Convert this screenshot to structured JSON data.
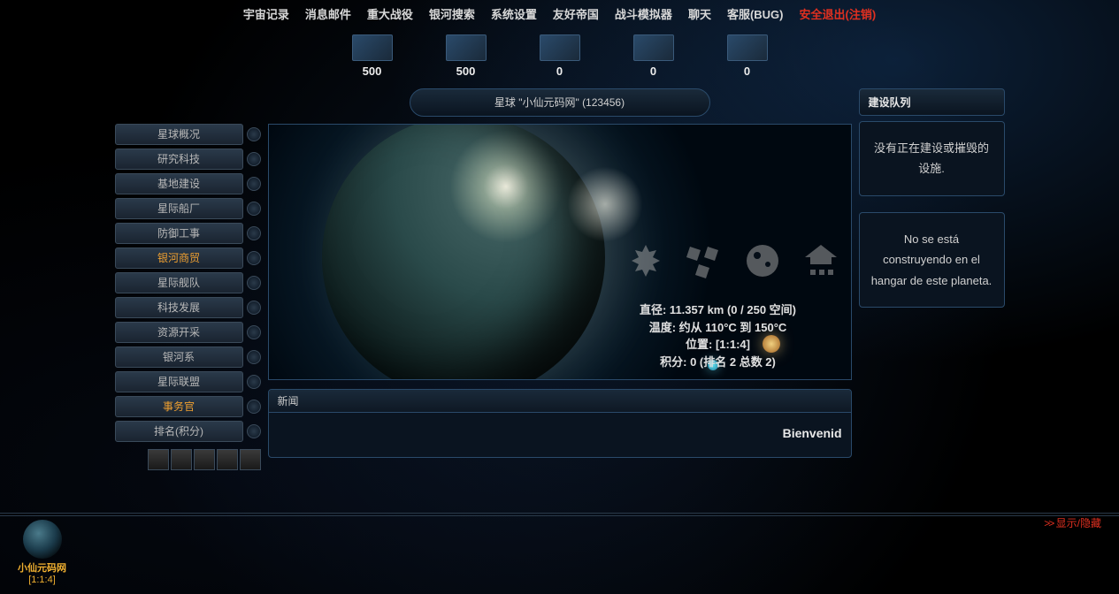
{
  "topnav": [
    {
      "label": "宇宙记录",
      "danger": false
    },
    {
      "label": "消息邮件",
      "danger": false
    },
    {
      "label": "重大战役",
      "danger": false
    },
    {
      "label": "银河搜索",
      "danger": false
    },
    {
      "label": "系统设置",
      "danger": false
    },
    {
      "label": "友好帝国",
      "danger": false
    },
    {
      "label": "战斗模拟器",
      "danger": false
    },
    {
      "label": "聊天",
      "danger": false
    },
    {
      "label": "客服(BUG)",
      "danger": false
    },
    {
      "label": "安全退出(注销)",
      "danger": true
    }
  ],
  "resources": [
    {
      "name": "metal",
      "value": "500"
    },
    {
      "name": "crystal",
      "value": "500"
    },
    {
      "name": "deuterium",
      "value": "0"
    },
    {
      "name": "darkmatter",
      "value": "0"
    },
    {
      "name": "energy",
      "value": "0"
    }
  ],
  "planet_title": "星球 \"小仙元码网\" (123456)",
  "leftmenu": [
    {
      "label": "星球概况",
      "active": false
    },
    {
      "label": "研究科技",
      "active": false
    },
    {
      "label": "基地建设",
      "active": false
    },
    {
      "label": "星际船厂",
      "active": false
    },
    {
      "label": "防御工事",
      "active": false
    },
    {
      "label": "银河商贸",
      "active": true
    },
    {
      "label": "星际舰队",
      "active": false
    },
    {
      "label": "科技发展",
      "active": false
    },
    {
      "label": "资源开采",
      "active": false
    },
    {
      "label": "银河系",
      "active": false
    },
    {
      "label": "星际联盟",
      "active": false
    },
    {
      "label": "事务官",
      "active": true
    },
    {
      "label": "排名(积分)",
      "active": false
    }
  ],
  "planet_info": {
    "line1": "直径: 11.357 km (0 / 250 空间)",
    "line2": "温度: 约从 110°C 到 150°C",
    "line3": "位置: [1:1:4]",
    "line4": "积分: 0 (排名 2 总数 2)"
  },
  "news": {
    "header": "新闻",
    "ticker": "Bienvenid"
  },
  "right": {
    "header": "建设队列",
    "box1": "没有正在建设或摧毁的设施.",
    "box2": "No se está construyendo en el hangar de este planeta."
  },
  "toggle": "显示/隐藏",
  "selected_planet": {
    "name": "小仙元码网",
    "coord": "[1:1:4]"
  }
}
